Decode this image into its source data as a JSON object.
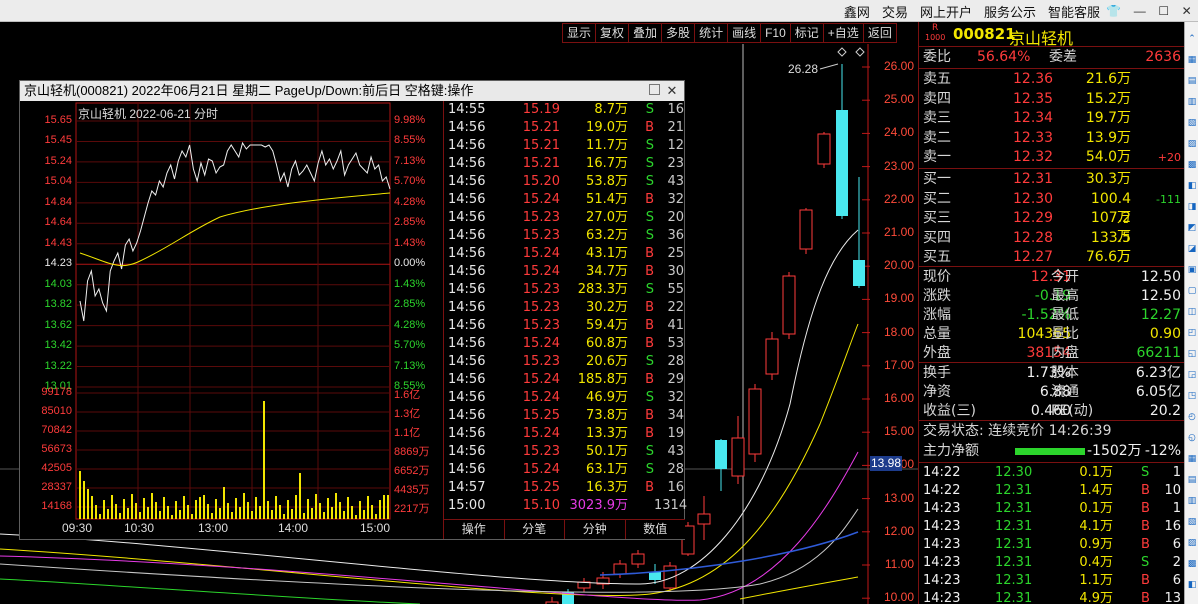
{
  "topmenu": [
    "鑫网",
    "交易",
    "网上开户",
    "服务公示",
    "智能客服"
  ],
  "toolbar": [
    "显示",
    "复权",
    "叠加",
    "多股",
    "统计",
    "画线",
    "F10",
    "标记",
    "+自选",
    "返回"
  ],
  "kline_axis": {
    "labels": [
      "26.00",
      "25.00",
      "24.00",
      "23.00",
      "22.00",
      "21.00",
      "20.00",
      "19.00",
      "18.00",
      "17.00",
      "16.00",
      "15.00",
      "14.00",
      "13.00",
      "12.00",
      "11.00",
      "10.00"
    ],
    "high_mark": "26.28",
    "cursor_price": "13.98"
  },
  "popup": {
    "title": "京山轻机(000821) 2022年06月21日 星期二 PageUp/Down:前后日 空格键:操作",
    "chart_title": "京山轻机  2022-06-21 分时",
    "left_axis": [
      "15.65",
      "15.45",
      "15.24",
      "15.04",
      "14.84",
      "14.64",
      "14.43",
      "14.23",
      "14.03",
      "13.82",
      "13.62",
      "13.42",
      "13.22",
      "13.01"
    ],
    "right_axis": [
      "9.98%",
      "8.55%",
      "7.13%",
      "5.70%",
      "4.28%",
      "2.85%",
      "1.43%",
      "0.00%",
      "1.43%",
      "2.85%",
      "4.28%",
      "5.70%",
      "7.13%",
      "8.55%"
    ],
    "vol_left": [
      "99178",
      "85010",
      "70842",
      "56673",
      "42505",
      "28337",
      "14168"
    ],
    "vol_right": [
      "1.6亿",
      "1.3亿",
      "1.1亿",
      "8869万",
      "6652万",
      "4435万",
      "2217万"
    ],
    "time_axis": [
      "09:30",
      "10:30",
      "13:00",
      "14:00",
      "15:00"
    ],
    "tabs": [
      "操作",
      "分笔",
      "分钟",
      "数值"
    ],
    "trades": [
      [
        "14:55",
        "15.19",
        "8.7万",
        "S",
        "16"
      ],
      [
        "14:56",
        "15.21",
        "19.0万",
        "B",
        "21"
      ],
      [
        "14:56",
        "15.21",
        "11.7万",
        "S",
        "12"
      ],
      [
        "14:56",
        "15.21",
        "16.7万",
        "S",
        "23"
      ],
      [
        "14:56",
        "15.20",
        "53.8万",
        "S",
        "43"
      ],
      [
        "14:56",
        "15.24",
        "51.4万",
        "B",
        "32"
      ],
      [
        "14:56",
        "15.23",
        "27.0万",
        "S",
        "20"
      ],
      [
        "14:56",
        "15.23",
        "63.2万",
        "S",
        "36"
      ],
      [
        "14:56",
        "15.24",
        "43.1万",
        "B",
        "25"
      ],
      [
        "14:56",
        "15.24",
        "34.7万",
        "B",
        "30"
      ],
      [
        "14:56",
        "15.23",
        "283.3万",
        "S",
        "55"
      ],
      [
        "14:56",
        "15.23",
        "30.2万",
        "B",
        "22"
      ],
      [
        "14:56",
        "15.23",
        "59.4万",
        "B",
        "41"
      ],
      [
        "14:56",
        "15.24",
        "60.8万",
        "B",
        "53"
      ],
      [
        "14:56",
        "15.23",
        "20.6万",
        "S",
        "28"
      ],
      [
        "14:56",
        "15.24",
        "185.8万",
        "B",
        "29"
      ],
      [
        "14:56",
        "15.24",
        "46.9万",
        "S",
        "32"
      ],
      [
        "14:56",
        "15.25",
        "73.8万",
        "B",
        "34"
      ],
      [
        "14:56",
        "15.24",
        "13.3万",
        "B",
        "19"
      ],
      [
        "14:56",
        "15.23",
        "50.1万",
        "S",
        "43"
      ],
      [
        "14:56",
        "15.24",
        "63.1万",
        "S",
        "28"
      ],
      [
        "14:57",
        "15.25",
        "16.3万",
        "B",
        "16"
      ],
      [
        "15:00",
        "15.10",
        "3023.9万",
        "",
        "1314"
      ]
    ]
  },
  "panel": {
    "badge": "R 1000",
    "code": "000821",
    "name": "京山轻机",
    "weibi_label": "委比",
    "weibi": "56.64%",
    "weicha_label": "委差",
    "weicha": "2636",
    "asks": [
      [
        "卖五",
        "12.36",
        "21.6万",
        ""
      ],
      [
        "卖四",
        "12.35",
        "15.2万",
        ""
      ],
      [
        "卖三",
        "12.34",
        "19.7万",
        ""
      ],
      [
        "卖二",
        "12.33",
        "13.9万",
        ""
      ],
      [
        "卖一",
        "12.32",
        "54.0万",
        "+20"
      ]
    ],
    "bids": [
      [
        "买一",
        "12.31",
        "30.3万",
        ""
      ],
      [
        "买二",
        "12.30",
        "100.4万",
        "-111"
      ],
      [
        "买三",
        "12.29",
        "107.2万",
        ""
      ],
      [
        "买四",
        "12.28",
        "133.5万",
        ""
      ],
      [
        "买五",
        "12.27",
        "76.6万",
        ""
      ]
    ],
    "stats": [
      [
        "现价",
        "12.31",
        "今开",
        "12.50"
      ],
      [
        "涨跌",
        "-0.19",
        "最高",
        "12.50"
      ],
      [
        "涨幅",
        "-1.52%",
        "最低",
        "12.27"
      ],
      [
        "总量",
        "104365",
        "量比",
        "0.90"
      ],
      [
        "外盘",
        "38154",
        "内盘",
        "66211"
      ]
    ],
    "stats2": [
      [
        "换手",
        "1.73%",
        "股本",
        "6.23亿"
      ],
      [
        "净资",
        "6.88",
        "流通",
        "6.05亿"
      ],
      [
        "收益(三)",
        "0.460",
        "PE(动)",
        "20.2"
      ]
    ],
    "status": "交易状态: 连续竞价 14:26:39",
    "main_label": "主力净额",
    "main_val": "-1502万",
    "main_pct": "-12%",
    "ticks": [
      [
        "14:22",
        "12.30",
        "0.1万",
        "S",
        "1"
      ],
      [
        "14:22",
        "12.31",
        "1.4万",
        "B",
        "10"
      ],
      [
        "14:23",
        "12.31",
        "0.1万",
        "B",
        "1"
      ],
      [
        "14:23",
        "12.31",
        "4.1万",
        "B",
        "16"
      ],
      [
        "14:23",
        "12.31",
        "0.9万",
        "B",
        "6"
      ],
      [
        "14:23",
        "12.31",
        "0.4万",
        "S",
        "2"
      ],
      [
        "14:23",
        "12.31",
        "1.1万",
        "B",
        "6"
      ],
      [
        "14:23",
        "12.31",
        "4.9万",
        "B",
        "13"
      ]
    ]
  }
}
